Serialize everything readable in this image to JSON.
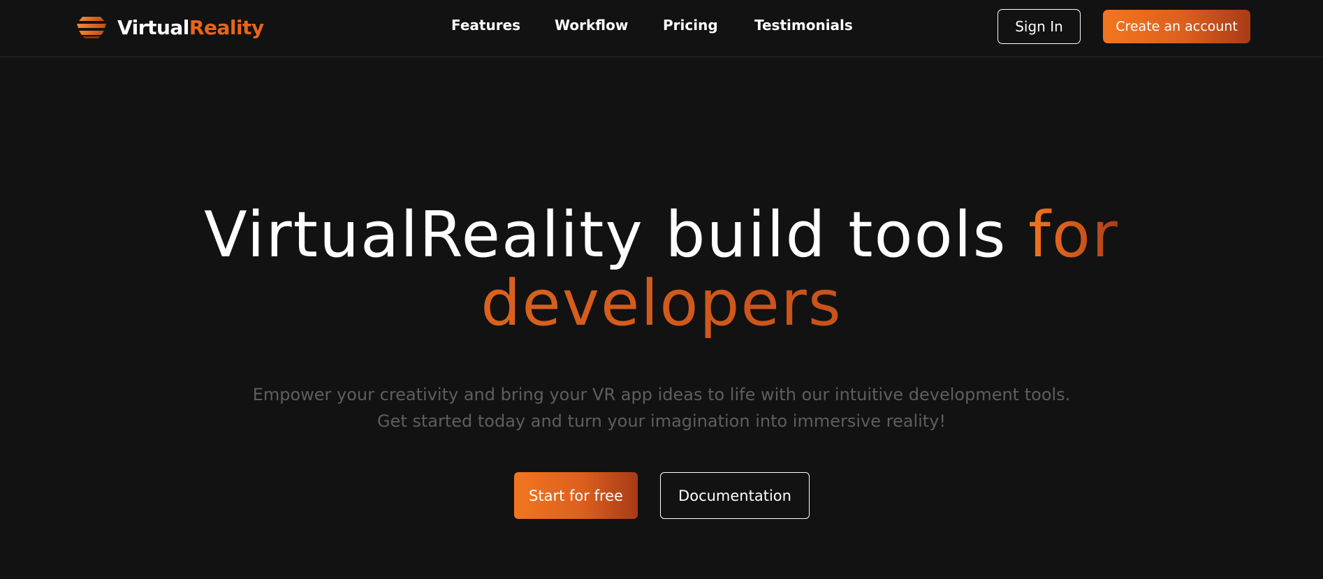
{
  "brand": {
    "name_part1": "Virtual",
    "name_part2": "Reality",
    "logo_icon": "stacked-layers-icon",
    "accent_color": "#e8651c",
    "accent_dark": "#a83b16"
  },
  "nav": {
    "links": [
      {
        "label": "Features"
      },
      {
        "label": "Workflow"
      },
      {
        "label": "Pricing"
      },
      {
        "label": "Testimonials"
      }
    ],
    "sign_in_label": "Sign In",
    "create_account_label": "Create an account"
  },
  "hero": {
    "title_white": "VirtualReality build tools ",
    "title_accent_1": "for",
    "title_accent_2": "developers",
    "subtitle_line1": "Empower your creativity and bring your VR app ideas to life with our intuitive development tools.",
    "subtitle_line2": "Get started today and turn your imagination into immersive reality!",
    "primary_cta": "Start for free",
    "secondary_cta": "Documentation"
  },
  "colors": {
    "background": "#121212",
    "text": "#ffffff",
    "muted_text": "#5e5e5e"
  }
}
